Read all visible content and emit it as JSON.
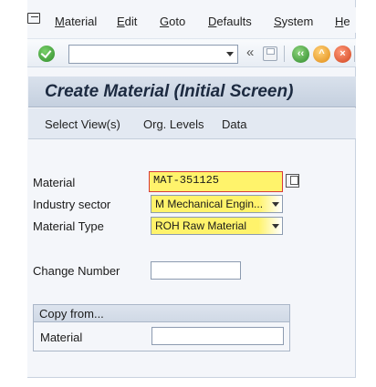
{
  "menubar": {
    "items": [
      "Material",
      "Edit",
      "Goto",
      "Defaults",
      "System",
      "He"
    ]
  },
  "toolbar": {
    "command_value": "",
    "back_glyph": "«"
  },
  "screen": {
    "title": "Create Material (Initial Screen)"
  },
  "app_toolbar": {
    "buttons": [
      "Select View(s)",
      "Org. Levels",
      "Data"
    ]
  },
  "form": {
    "material": {
      "label": "Material",
      "value": "MAT-351125"
    },
    "industry_sector": {
      "label": "Industry sector",
      "value": "M Mechanical Engin..."
    },
    "material_type": {
      "label": "Material Type",
      "value": "ROH Raw Material"
    },
    "change_number": {
      "label": "Change Number",
      "value": ""
    }
  },
  "copy_from": {
    "title": "Copy from...",
    "material": {
      "label": "Material",
      "value": ""
    }
  },
  "colors": {
    "highlight": "#fff36b",
    "required_border": "#d83a3a",
    "title_bg": "#c5d0df"
  }
}
